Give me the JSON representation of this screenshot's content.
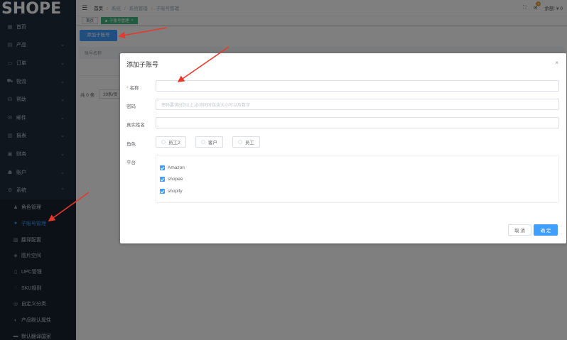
{
  "logo": "SHOPE",
  "sidebar": {
    "items": [
      {
        "label": "首页",
        "icon": "dashboard-icon",
        "has_children": false
      },
      {
        "label": "产品",
        "icon": "product-icon",
        "has_children": true
      },
      {
        "label": "订单",
        "icon": "order-icon",
        "has_children": true
      },
      {
        "label": "物流",
        "icon": "truck-icon",
        "has_children": true
      },
      {
        "label": "帮助",
        "icon": "headset-icon",
        "has_children": true
      },
      {
        "label": "邮件",
        "icon": "mail-icon",
        "has_children": true
      },
      {
        "label": "报表",
        "icon": "report-icon",
        "has_children": true
      },
      {
        "label": "财务",
        "icon": "finance-icon",
        "has_children": true
      },
      {
        "label": "账户",
        "icon": "account-icon",
        "has_children": true
      },
      {
        "label": "系统",
        "icon": "gear-icon",
        "has_children": true,
        "expanded": true
      }
    ],
    "sub_items": [
      {
        "label": "角色管理",
        "icon": "users-icon",
        "active": false
      },
      {
        "label": "子账号管理",
        "icon": "user-circle-icon",
        "active": true
      },
      {
        "label": "翻译配置",
        "icon": "translate-icon",
        "active": false
      },
      {
        "label": "图片空间",
        "icon": "image-icon",
        "active": false
      },
      {
        "label": "UPC管理",
        "icon": "barcode-icon",
        "active": false
      },
      {
        "label": "SKU规则",
        "icon": "rule-icon",
        "active": false
      },
      {
        "label": "自定义分类",
        "icon": "category-icon",
        "active": false
      },
      {
        "label": "产品默认属性",
        "icon": "attribute-icon",
        "active": false
      },
      {
        "label": "默认翻译国家",
        "icon": "flag-icon",
        "active": false
      }
    ]
  },
  "breadcrumb": [
    "首页",
    "系统",
    "系统管理",
    "子账号管理"
  ],
  "topbar": {
    "balance": "余额: ¥ 0",
    "bell_badge": "0"
  },
  "tags": [
    {
      "label": "首页",
      "active": false
    },
    {
      "label": "子账号管理",
      "active": true
    }
  ],
  "page": {
    "add_button": "添加子账号",
    "table_header": "账号名称",
    "total": "共 0 条",
    "page_size": "20条/页"
  },
  "dialog": {
    "title": "添加子账号",
    "close": "×",
    "fields": {
      "name_label": "名称",
      "name_value": "",
      "password_label": "密码",
      "password_placeholder": "密码要求8位以上,必须同时包含大小写以及数字",
      "realname_label": "真实姓名",
      "realname_value": "",
      "role_label": "角色",
      "roles": [
        "员工2",
        "客户",
        "员工"
      ],
      "platform_label": "平台",
      "platforms": [
        {
          "label": "Amazon",
          "checked": true
        },
        {
          "label": "shopee",
          "checked": true
        },
        {
          "label": "shopify",
          "checked": true
        }
      ]
    },
    "cancel": "取 消",
    "confirm": "确 定"
  },
  "colors": {
    "sidebar_bg": "#1f2d3d",
    "primary": "#409eff",
    "tag_active": "#42b983",
    "annotation_red": "#e8382b"
  }
}
